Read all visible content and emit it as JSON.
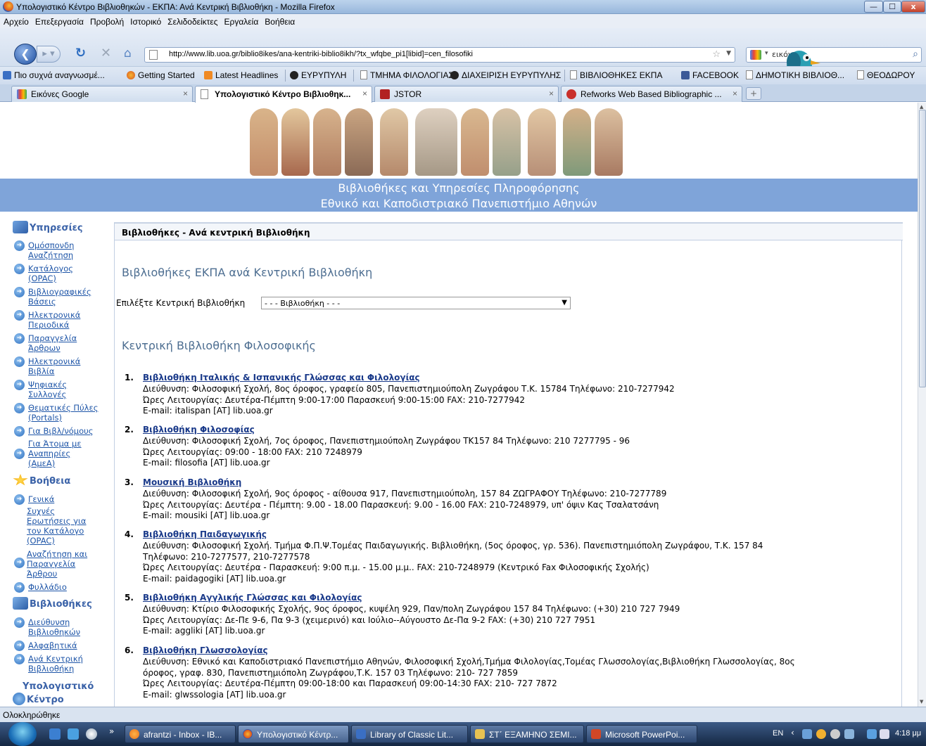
{
  "window": {
    "title": "Υπολογιστικό Κέντρο Βιβλιοθηκών - ΕΚΠΑ: Ανά Κεντρική Βιβλιοθήκη - Mozilla Firefox",
    "min_label": "—",
    "max_label": "☐",
    "close_label": "x"
  },
  "menu": [
    "Αρχείο",
    "Επεξεργασία",
    "Προβολή",
    "Ιστορικό",
    "Σελιδοδείκτες",
    "Εργαλεία",
    "Βοήθεια"
  ],
  "navbar": {
    "url": "http://www.lib.uoa.gr/biblio8ikes/ana-kentriki-biblio8ikh/?tx_wfqbe_pi1[libid]=cen_filosofiki",
    "search_text": "εικόνες"
  },
  "bookmarks": [
    "Πιο συχνά αναγνωσμέ...",
    "Getting Started",
    "Latest Headlines",
    "ΕΥΡΥΠΥΛΗ",
    "ΤΜΗΜΑ ΦΙΛΟΛΟΓΙΑΣ",
    "ΔΙΑΧΕΙΡΙΣΗ ΕΥΡΥΠΥΛΗΣ",
    "ΒΙΒΛΙΟΘΗΚΕΣ ΕΚΠΑ",
    "FACEBOOK",
    "ΔΗΜΟΤΙΚΗ ΒΙΒΛΙΟΘ...",
    "ΘΕΟΔΩΡΟΥ"
  ],
  "tabs": [
    {
      "label": "Εικόνες Google",
      "active": false
    },
    {
      "label": "Υπολογιστικό Κέντρο Βιβλιοθηκ...",
      "active": true
    },
    {
      "label": "JSTOR",
      "active": false
    },
    {
      "label": "Refworks Web Based Bibliographic ...",
      "active": false
    }
  ],
  "tab_close": "×",
  "newtab": "+",
  "banner": {
    "line1": "Βιβλιοθήκες και Υπηρεσίες Πληροφόρησης",
    "line2": "Εθνικό και Καποδιστριακό Πανεπιστήμιο Αθηνών"
  },
  "sidebar": {
    "services_title": "Υπηρεσίες",
    "services": [
      [
        "Ομόσπονδη",
        "Αναζήτηση"
      ],
      [
        "Κατάλογος",
        "(OPAC)"
      ],
      [
        "Βιβλιογραφικές",
        "Βάσεις"
      ],
      [
        "Ηλεκτρονικά",
        "Περιοδικά"
      ],
      [
        "Παραγγελία",
        "Άρθρων"
      ],
      [
        "Ηλεκτρονικά",
        "Βιβλία"
      ],
      [
        "Ψηφιακές",
        "Συλλογές"
      ],
      [
        "Θεματικές Πύλες",
        "(Portals)"
      ],
      [
        "Για Βιβλ/νόμους"
      ],
      [
        "Για Άτομα με",
        "Αναπηρίες",
        "(ΑμεΑ)"
      ]
    ],
    "help_title": "Βοήθεια",
    "help": [
      [
        "Γενικά"
      ],
      [
        "Συχνές",
        "Ερωτήσεις για",
        "τον Κατάλογο",
        "(OPAC)"
      ],
      [
        "Αναζήτηση και",
        "Παραγγελία",
        "Άρθρου"
      ],
      [
        "Φυλλάδιο"
      ]
    ],
    "libraries_title": "Βιβλιοθήκες",
    "libraries": [
      [
        "Διεύθυνση",
        "Βιβλιοθηκών"
      ],
      [
        "Αλφαβητικά"
      ],
      [
        "Ανά Κεντρική",
        "Βιβλιοθήκη"
      ]
    ],
    "computing_title_1": "Υπολογιστικό",
    "computing_title_2": "Κέντρο"
  },
  "main": {
    "header": "Βιβλιοθήκες - Ανά κεντρική Βιβλιοθήκη",
    "heading": "Βιβλιοθήκες ΕΚΠΑ ανά Κεντρική Βιβλιοθήκη",
    "choose_label": "Επιλέξτε Κεντρική Βιβλιοθήκη",
    "select_value": "- - - Βιβλιοθήκη - - -",
    "central_heading": "Κεντρική Βιβλιοθήκη Φιλοσοφικής",
    "libraries": [
      {
        "num": "1.",
        "name": "Βιβλιοθήκη Ιταλικής & Ισπανικής Γλώσσας και Φιλολογίας",
        "lines": [
          "Διεύθυνση: Φιλοσοφική Σχολή, 8ος όροφος, γραφείο 805, Πανεπιστημιούπολη Ζωγράφου Τ.Κ. 15784 Τηλέφωνο: 210-7277942",
          "Ώρες Λειτουργίας: Δευτέρα-Πέμπτη 9:00-17:00 Παρασκευή 9:00-15:00 FAX: 210-7277942",
          "E-mail: italispan [AT] lib.uoa.gr"
        ]
      },
      {
        "num": "2.",
        "name": "Βιβλιοθήκη Φιλοσοφίας",
        "lines": [
          "Διεύθυνση: Φιλοσοφική Σχολή, 7ος όροφος, Πανεπιστημιούπολη Ζωγράφου ΤΚ157 84 Τηλέφωνο: 210 7277795 - 96",
          "Ώρες Λειτουργίας: 09:00 - 18:00 FAX: 210 7248979",
          "E-mail: filosofia [AT] lib.uoa.gr"
        ]
      },
      {
        "num": "3.",
        "name": "Μουσική Βιβλιοθήκη",
        "lines": [
          "Διεύθυνση: Φιλοσοφική Σχολή, 9ος όροφος - αίθουσα 917, Πανεπιστημιούπολη, 157 84 ΖΩΓΡΑΦΟΥ Τηλέφωνο: 210-7277789",
          "Ώρες Λειτουργίας: Δευτέρα - Πέμπτη: 9.00 - 18.00 Παρασκευή: 9.00 - 16.00 FAX: 210-7248979, υπ' όψιν Κας Τσαλατσάνη",
          "E-mail: mousiki [AT] lib.uoa.gr"
        ]
      },
      {
        "num": "4.",
        "name": "Βιβλιοθήκη Παιδαγωγικής",
        "lines": [
          "Διεύθυνση: Φιλοσοφική Σχολή. Τμήμα Φ.Π.Ψ.Τομέας Παιδαγωγικής. Βιβλιοθήκη, (5ος όροφος, γρ. 536). Πανεπιστημιόπολη Ζωγράφου, Τ.Κ. 157 84",
          "Τηλέφωνο: 210-7277577, 210-7277578",
          "Ώρες Λειτουργίας: Δευτέρα - Παρασκευή: 9:00 π.μ. - 15.00 μ.μ.. FAX: 210-7248979 (Κεντρικό Fax Φιλοσοφικής Σχολής)",
          "E-mail: paidagogiki [AT] lib.uoa.gr"
        ]
      },
      {
        "num": "5.",
        "name": "Βιβλιοθήκη Αγγλικής Γλώσσας και Φιλολογίας",
        "lines": [
          "Διεύθυνση: Κτίριο Φιλοσοφικής Σχολής, 9ος όροφος, κυψέλη 929, Παν/πολη Ζωγράφου 157 84 Τηλέφωνο: (+30) 210 727 7949",
          "Ώρες Λειτουργίας: Δε-Πε 9-6, Πα 9-3 (χειμερινό) και Ιούλιο--Αύγουστο Δε-Πα 9-2 FAX: (+30) 210 727 7951",
          "E-mail: aggliki [AT] lib.uoa.gr"
        ]
      },
      {
        "num": "6.",
        "name": "Βιβλιοθήκη Γλωσσολογίας",
        "lines": [
          "Διεύθυνση: Εθνικό και Καποδιστριακό Πανεπιστήμιο Αθηνών, Φιλοσοφική Σχολή,Τμήμα Φιλολογίας,Τομέας Γλωσσολογίας,Βιβλιοθήκη Γλωσσολογίας, 8ος",
          "όροφος, γραφ. 830, Πανεπιστημιόπολη Ζωγράφου,Τ.Κ. 157 03 Τηλέφωνο: 210- 727 7859",
          "Ώρες Λειτουργίας: Δευτέρα-Πέμπτη 09:00-18:00 και Παρασκευή 09:00-14:30 FAX: 210- 727 7872",
          "E-mail: glwssologia [AT] lib.uoa.gr"
        ]
      }
    ]
  },
  "status": "Ολοκληρώθηκε",
  "taskbar": {
    "chevron": "»",
    "tasks": [
      {
        "label": "afrantzi - Inbox - IB...",
        "active": false
      },
      {
        "label": "Υπολογιστικό Κέντρ...",
        "active": true
      },
      {
        "label": "Library of Classic Lit...",
        "active": false
      },
      {
        "label": "ΣΤ΄ ΕΞΑΜΗΝΟ ΣΕΜΙ...",
        "active": false
      },
      {
        "label": "Microsoft PowerPoi...",
        "active": false
      }
    ],
    "lang": "EN",
    "clock": "4:18 μμ"
  }
}
